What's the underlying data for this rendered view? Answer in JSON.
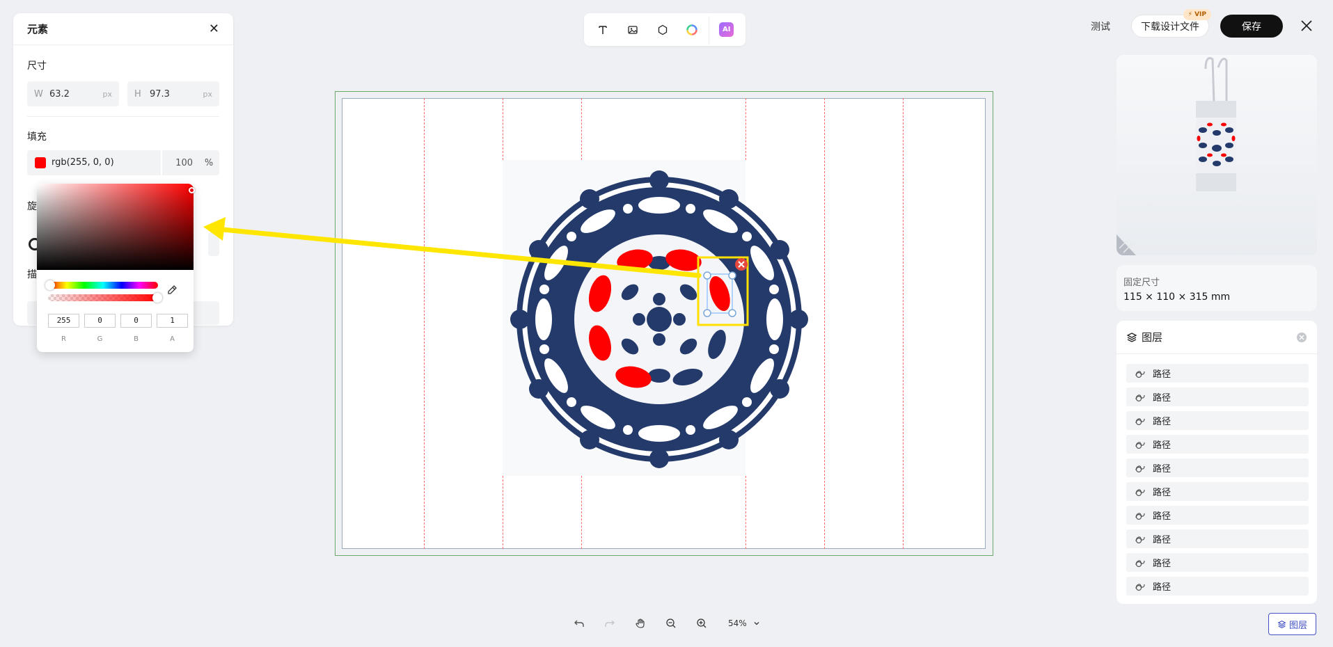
{
  "element_panel": {
    "title": "元素",
    "size_label": "尺寸",
    "width": {
      "key": "W",
      "value": "63.2",
      "unit": "px"
    },
    "height": {
      "key": "H",
      "value": "97.3",
      "unit": "px"
    },
    "fill_label": "填充",
    "fill_color": "#ff0000",
    "fill_value": "rgb(255, 0, 0)",
    "fill_opacity": "100",
    "fill_opacity_unit": "%",
    "rotation_label": "旋",
    "stroke_label": "描"
  },
  "color_picker": {
    "r": "255",
    "g": "0",
    "b": "0",
    "a": "1",
    "labels": {
      "r": "R",
      "g": "G",
      "b": "B",
      "a": "A"
    }
  },
  "toolbar": {
    "ai_label": "AI"
  },
  "top_actions": {
    "test": "测试",
    "download": "下载设计文件",
    "vip": "VIP",
    "save": "保存"
  },
  "product_size": {
    "title": "固定尺寸",
    "value": "115 × 110 × 315 mm"
  },
  "layers_panel": {
    "title": "图层",
    "items": [
      "路径",
      "路径",
      "路径",
      "路径",
      "路径",
      "路径",
      "路径",
      "路径",
      "路径",
      "路径"
    ]
  },
  "zoom": {
    "value": "54%"
  },
  "layers_toggle": {
    "label": "图层"
  },
  "colors": {
    "pattern_blue": "#233a6b",
    "highlight_red": "#ff0000",
    "annotation_yellow": "#ffe800",
    "guide_red": "#ff6b6b"
  }
}
